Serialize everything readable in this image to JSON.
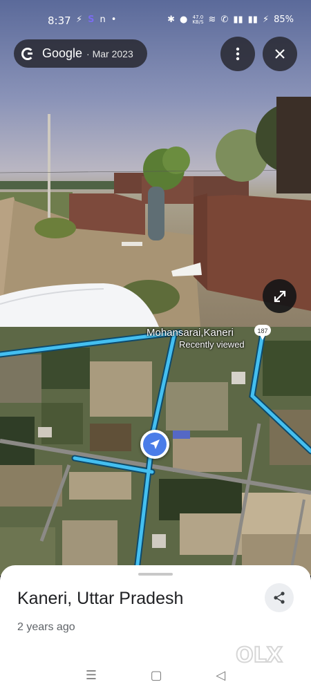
{
  "status_bar": {
    "time": "8:37",
    "network_speed": "47.0",
    "network_unit": "KB/S",
    "battery": "85%"
  },
  "street_view": {
    "source": "Google",
    "date": "· Mar 2023"
  },
  "map": {
    "place_label": "Mohansarai,Kaneri",
    "place_sublabel": "Recently viewed",
    "badge_text": "187"
  },
  "sheet": {
    "title": "Kaneri, Uttar Pradesh",
    "age": "2 years ago",
    "watermark": "OLX"
  },
  "icons": {
    "more": "more-vert-icon",
    "close": "close-icon",
    "expand": "expand-icon",
    "share": "share-icon",
    "nav_arrow": "navigation-arrow-icon"
  },
  "colors": {
    "road_blue": "#3fb5ea",
    "nav_blue": "#4a7ce8"
  }
}
